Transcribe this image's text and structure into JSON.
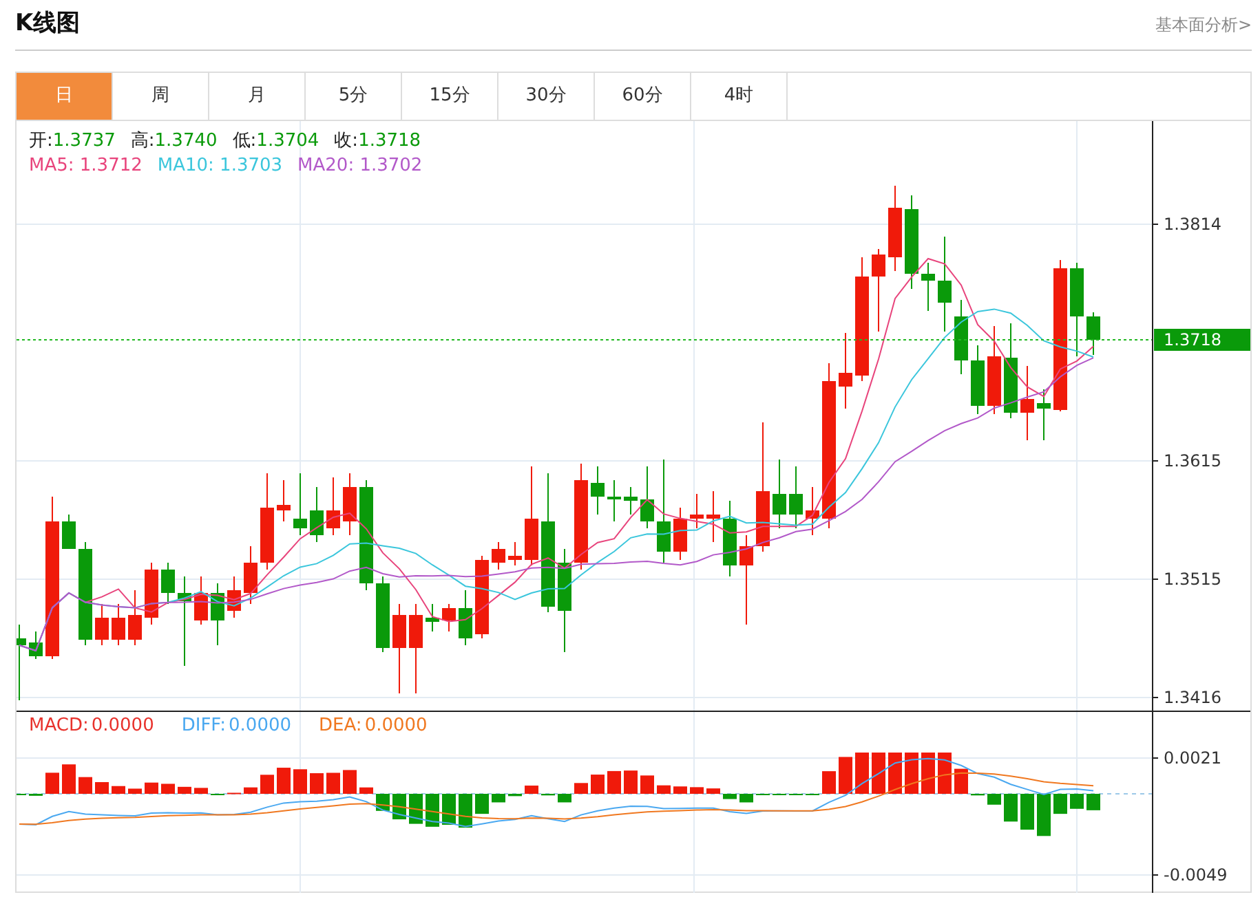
{
  "header": {
    "title": "K线图",
    "link": "基本面分析>"
  },
  "tabs": [
    {
      "label": "日",
      "selected": true
    },
    {
      "label": "周",
      "selected": false
    },
    {
      "label": "月",
      "selected": false
    },
    {
      "label": "5分",
      "selected": false
    },
    {
      "label": "15分",
      "selected": false
    },
    {
      "label": "30分",
      "selected": false
    },
    {
      "label": "60分",
      "selected": false
    },
    {
      "label": "4时",
      "selected": false
    }
  ],
  "quote": [
    {
      "label": "开:",
      "value": "1.3737"
    },
    {
      "label": "高:",
      "value": "1.3740"
    },
    {
      "label": "低:",
      "value": "1.3704"
    },
    {
      "label": "收:",
      "value": "1.3718"
    }
  ],
  "moving_averages": [
    {
      "label": "MA5:",
      "value": "1.3712",
      "color": "#e8447c"
    },
    {
      "label": "MA10:",
      "value": "1.3703",
      "color": "#3bc6dc"
    },
    {
      "label": "MA20:",
      "value": "1.3702",
      "color": "#b259c9"
    }
  ],
  "price_axis": {
    "ticks": [
      "1.3814",
      "1.3615",
      "1.3515",
      "1.3416"
    ],
    "current_price": "1.3718"
  },
  "macd_legend": [
    {
      "label": "MACD:",
      "value": "0.0000",
      "color": "#e8322c"
    },
    {
      "label": "DIFF:",
      "value": "0.0000",
      "color": "#4aa8f0"
    },
    {
      "label": "DEA:",
      "value": "0.0000",
      "color": "#f07820"
    }
  ],
  "macd_axis": {
    "ticks": [
      "0.0021",
      "-0.0049"
    ]
  }
}
